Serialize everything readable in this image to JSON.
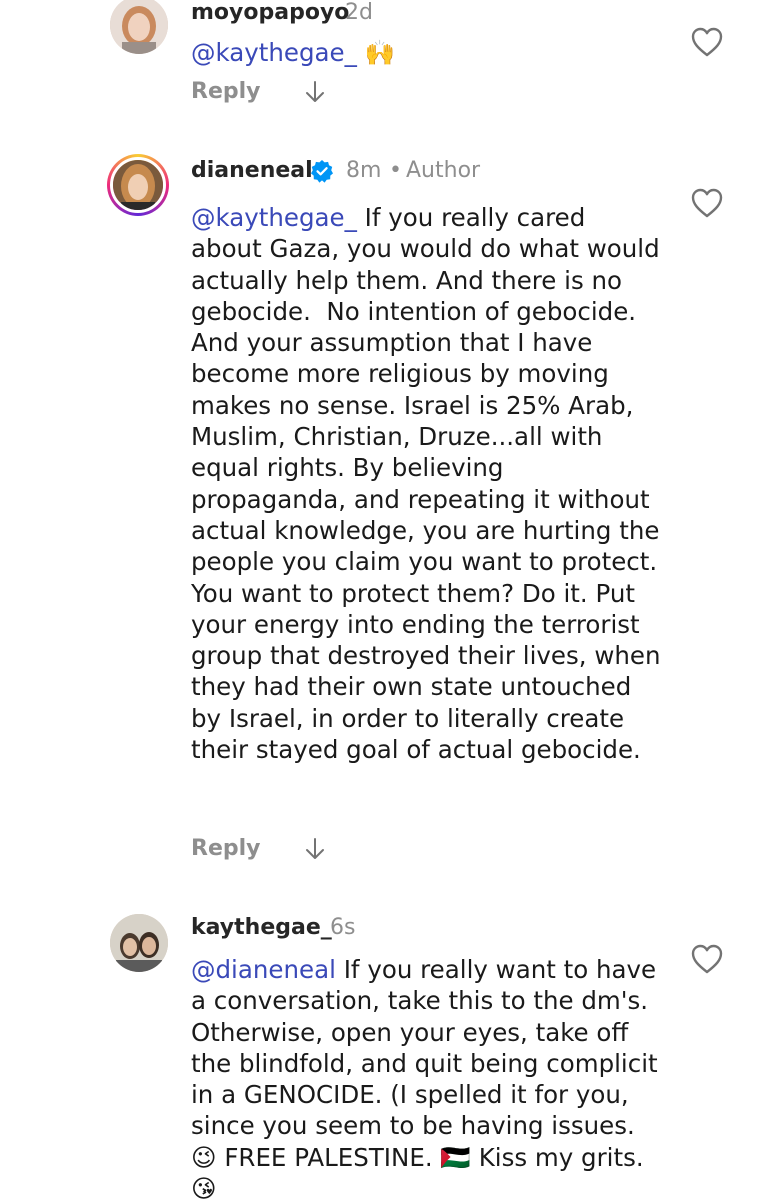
{
  "comments": [
    {
      "username": "moyopapoyo",
      "time": "2d",
      "mention": "@kaythegae_",
      "text": " 🙌",
      "reply_label": "Reply"
    },
    {
      "username": "dianeneal",
      "time": "8m",
      "separator": "•",
      "author_label": "Author",
      "mention": "@kaythegae_",
      "text": " If you really cared about Gaza, you would do what would actually help them. And there is no gebocide.  No intention of gebocide. And your assumption that I have become more religious by moving makes no sense. Israel is 25% Arab, Muslim, Christian, Druze...all with equal rights. By believing propaganda, and repeating it without actual knowledge, you are hurting the people you claim you want to protect. You want to protect them? Do it. Put your energy into ending the terrorist group that destroyed their lives, when they had their own state untouched by Israel, in order to literally create their stayed goal of actual gebocide.",
      "reply_label": "Reply"
    },
    {
      "username": "kaythegae_",
      "time": "6s",
      "mention": "@dianeneal",
      "text": " If you really want to have a conversation, take this to the dm's. Otherwise, open your eyes, take off the blindfold, and quit being complicit in a GENOCIDE. (I spelled it for you, since you seem to be having issues. 😉 FREE PALESTINE. 🇵🇸 Kiss my grits. 😘"
    }
  ],
  "colors": {
    "mention": "#3a49b8",
    "meta": "#8e8e8e",
    "verified": "#0095f6"
  },
  "icons": [
    "heart-icon",
    "down-arrow-icon",
    "verified-badge-icon"
  ]
}
